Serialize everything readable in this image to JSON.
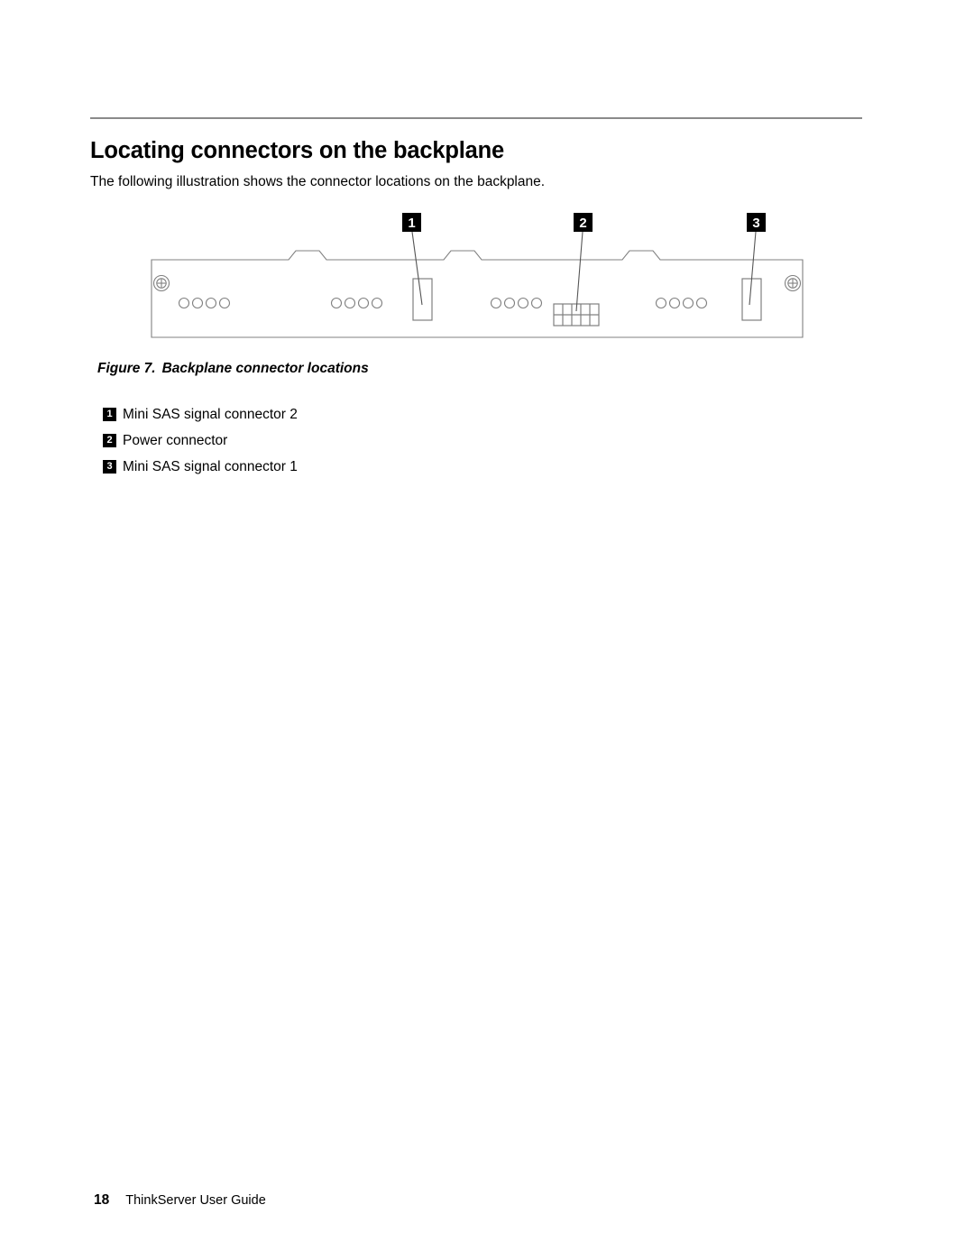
{
  "heading": "Locating connectors on the backplane",
  "intro": "The following illustration shows the connector locations on the backplane.",
  "figure": {
    "caption_number": "Figure 7.",
    "caption_title": "Backplane connector locations",
    "callouts": [
      {
        "number": "1",
        "target": "mini-sas-signal-connector-2"
      },
      {
        "number": "2",
        "target": "power-connector"
      },
      {
        "number": "3",
        "target": "mini-sas-signal-connector-1"
      }
    ],
    "diagram_parts": {
      "screw_holes": 2,
      "led_circle_groups": 4,
      "circles_per_group": 4,
      "mini_sas_connectors": 2,
      "power_connector_columns": 5,
      "power_connector_rows": 2,
      "top_notches": 3
    },
    "colors": {
      "outline": "#808080",
      "callout_box": "#000000",
      "callout_text": "#ffffff",
      "leader_line": "#555555"
    }
  },
  "legend": [
    {
      "number": "1",
      "label": "Mini SAS signal connector 2"
    },
    {
      "number": "2",
      "label": "Power connector"
    },
    {
      "number": "3",
      "label": "Mini SAS signal connector 1"
    }
  ],
  "footer": {
    "page_number": "18",
    "doc_title": "ThinkServer User Guide"
  }
}
